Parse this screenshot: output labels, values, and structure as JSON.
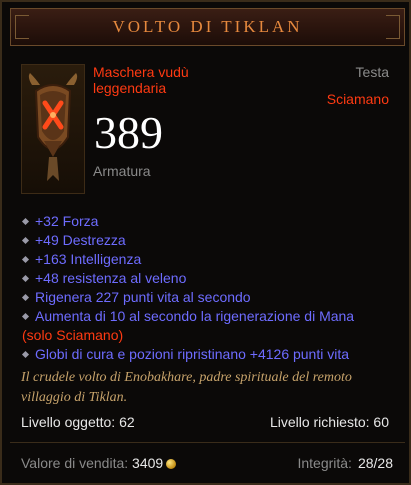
{
  "item": {
    "name": "VOLTO DI TIKLAN",
    "type_line1": "Maschera vudù",
    "type_line2": "leggendaria",
    "slot": "Testa",
    "class_req": "Sciamano",
    "armor_value": "389",
    "armor_label": "Armatura"
  },
  "affixes": [
    {
      "text": "+32 Forza"
    },
    {
      "text": "+49 Destrezza"
    },
    {
      "text": "+163 Intelligenza"
    },
    {
      "text": "+48 resistenza al veleno"
    },
    {
      "text": "Rigenera 227 punti vita al secondo"
    },
    {
      "text": "Aumenta di 10 al secondo la rigenerazione di Mana"
    },
    {
      "text": "Globi di cura e pozioni ripristinano +4126 punti vita"
    }
  ],
  "affix_note": "(solo Sciamano)",
  "flavor": "Il crudele volto di Enobakhare, padre spirituale del remoto villaggio di Tiklan.",
  "levels": {
    "item_level": "Livello oggetto: 62",
    "required_level": "Livello richiesto: 60"
  },
  "footer": {
    "sell_label": "Valore di vendita:",
    "sell_value": "3409",
    "durability_label": "Integrità:",
    "durability_value": "28/28"
  },
  "colors": {
    "legendary_orange": "#e6893e",
    "magic_blue": "#6e6cff",
    "red_text": "#ff3a12",
    "flavor_gold": "#c7a36b"
  },
  "icons": [
    "voodoo-mask-icon",
    "gold-coin-icon",
    "affix-bullet-icon"
  ]
}
